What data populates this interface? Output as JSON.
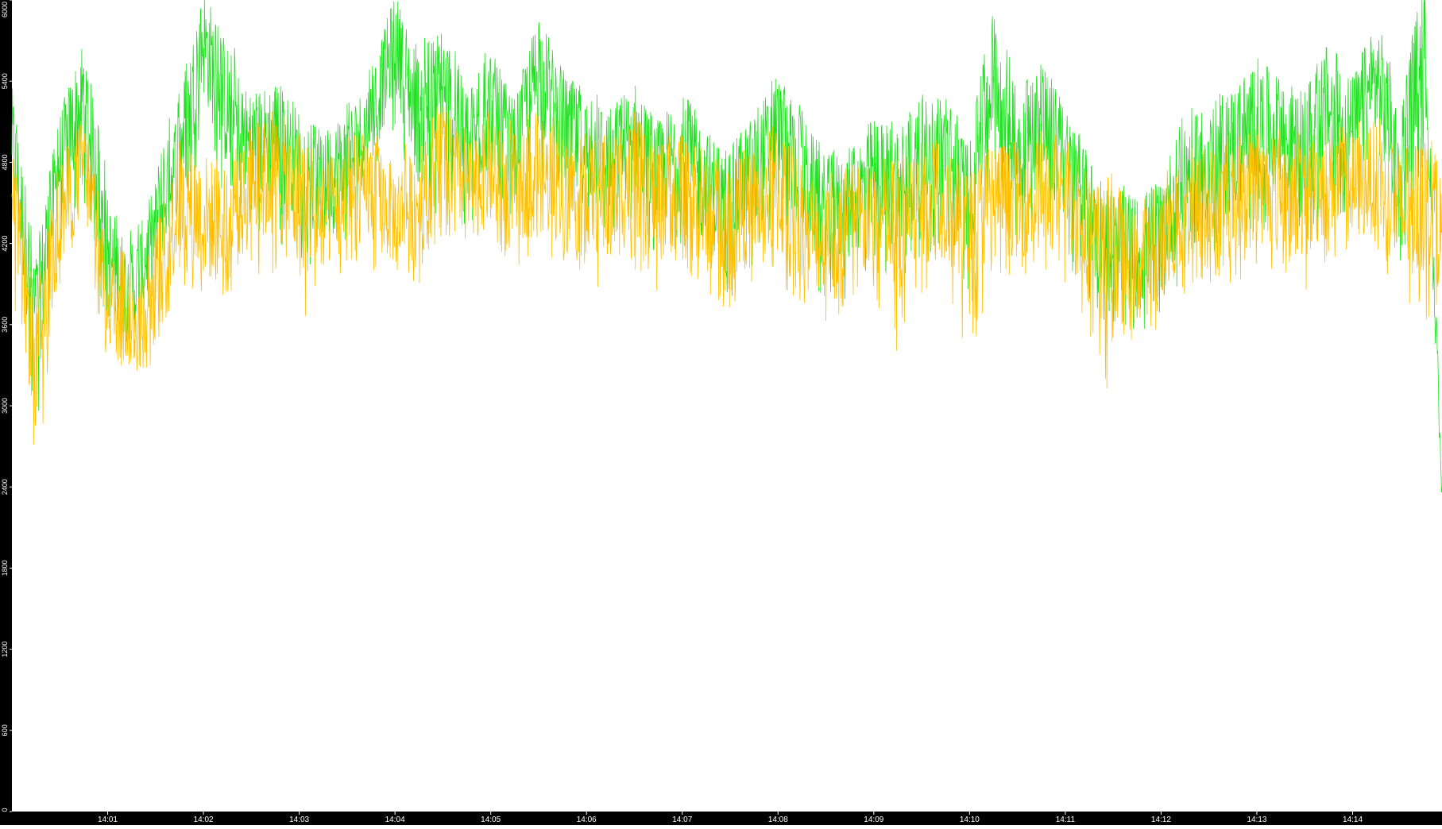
{
  "chart_data": {
    "type": "line",
    "title": "",
    "xlabel": "",
    "ylabel": "",
    "ylim": [
      0,
      6000
    ],
    "grid": false,
    "legend": "none",
    "yticks": [
      "0",
      "600",
      "1200",
      "1800",
      "2400",
      "3000",
      "3600",
      "4200",
      "4800",
      "5400",
      "6000"
    ],
    "xticks": [
      "14:01",
      "14:02",
      "14:03",
      "14:04",
      "14:05",
      "14:06",
      "14:07",
      "14:08",
      "14:09",
      "14:10",
      "14:11",
      "14:12",
      "14:13",
      "14:14"
    ],
    "x_range": [
      "14:00:00",
      "14:14:56"
    ],
    "colors": {
      "background": "#000000",
      "plot": "#ffffff",
      "green": "#22e022",
      "orange": "#ffc000"
    },
    "series": [
      {
        "color": "#22e022",
        "x": [
          "14:00:00",
          "14:00:15",
          "14:00:30",
          "14:00:45",
          "14:01:00",
          "14:01:15",
          "14:01:30",
          "14:01:45",
          "14:02:00",
          "14:02:15",
          "14:02:30",
          "14:02:45",
          "14:03:00",
          "14:03:15",
          "14:03:30",
          "14:03:45",
          "14:04:00",
          "14:04:15",
          "14:04:30",
          "14:04:45",
          "14:05:00",
          "14:05:15",
          "14:05:30",
          "14:05:45",
          "14:06:00",
          "14:06:15",
          "14:06:30",
          "14:06:45",
          "14:07:00",
          "14:07:15",
          "14:07:30",
          "14:07:45",
          "14:08:00",
          "14:08:15",
          "14:08:30",
          "14:08:45",
          "14:09:00",
          "14:09:15",
          "14:09:30",
          "14:09:45",
          "14:10:00",
          "14:10:15",
          "14:10:30",
          "14:10:45",
          "14:11:00",
          "14:11:15",
          "14:11:30",
          "14:11:45",
          "14:12:00",
          "14:12:15",
          "14:12:30",
          "14:12:45",
          "14:13:00",
          "14:13:15",
          "14:13:30",
          "14:13:45",
          "14:14:00",
          "14:14:15",
          "14:14:30",
          "14:14:45",
          "14:14:56"
        ],
        "values": [
          5000,
          3600,
          4800,
          5300,
          4100,
          3800,
          4300,
          4900,
          5700,
          5200,
          4900,
          5000,
          4800,
          4600,
          4800,
          5100,
          5700,
          5100,
          5300,
          4900,
          5200,
          4900,
          5500,
          5000,
          4900,
          4800,
          5000,
          4700,
          4900,
          4600,
          4500,
          4700,
          5000,
          4700,
          4400,
          4500,
          4700,
          4600,
          4800,
          4900,
          4500,
          5500,
          4900,
          5100,
          4800,
          4400,
          4200,
          4100,
          4300,
          4700,
          4800,
          4900,
          5100,
          5000,
          4900,
          5200,
          5000,
          5400,
          4800,
          5800,
          2400
        ],
        "min": [
          4400,
          2700,
          4200,
          4500,
          3500,
          3400,
          3800,
          4400,
          4900,
          4500,
          4300,
          4200,
          4100,
          3900,
          4200,
          4600,
          4900,
          4400,
          4400,
          4300,
          4500,
          4400,
          4700,
          4300,
          4300,
          4100,
          4300,
          4000,
          4200,
          3900,
          3800,
          3900,
          4300,
          4000,
          3700,
          3800,
          4000,
          3800,
          4100,
          4200,
          3800,
          4700,
          4100,
          4300,
          4100,
          3700,
          3600,
          3500,
          3700,
          3900,
          4100,
          4100,
          4300,
          4300,
          4200,
          4400,
          4300,
          4500,
          4000,
          4800,
          2300
        ],
        "max": [
          5400,
          4100,
          5200,
          5700,
          4700,
          4300,
          4800,
          5400,
          6000,
          5800,
          5300,
          5400,
          5200,
          5000,
          5300,
          5500,
          5900,
          5700,
          5900,
          5400,
          5700,
          5300,
          5900,
          5500,
          5400,
          5200,
          5400,
          5100,
          5400,
          5100,
          4900,
          5200,
          5500,
          5200,
          4900,
          4900,
          5200,
          5100,
          5300,
          5300,
          5000,
          6000,
          5400,
          5600,
          5200,
          4900,
          4700,
          4700,
          4800,
          5200,
          5300,
          5400,
          5600,
          5400,
          5400,
          5700,
          5500,
          5800,
          5300,
          6000,
          2600
        ]
      },
      {
        "color": "#ffc000",
        "x": [
          "14:00:00",
          "14:00:15",
          "14:00:30",
          "14:00:45",
          "14:01:00",
          "14:01:15",
          "14:01:30",
          "14:01:45",
          "14:02:00",
          "14:02:15",
          "14:02:30",
          "14:02:45",
          "14:03:00",
          "14:03:15",
          "14:03:30",
          "14:03:45",
          "14:04:00",
          "14:04:15",
          "14:04:30",
          "14:04:45",
          "14:05:00",
          "14:05:15",
          "14:05:30",
          "14:05:45",
          "14:06:00",
          "14:06:15",
          "14:06:30",
          "14:06:45",
          "14:07:00",
          "14:07:15",
          "14:07:30",
          "14:07:45",
          "14:08:00",
          "14:08:15",
          "14:08:30",
          "14:08:45",
          "14:09:00",
          "14:09:15",
          "14:09:30",
          "14:09:45",
          "14:10:00",
          "14:10:15",
          "14:10:30",
          "14:10:45",
          "14:11:00",
          "14:11:15",
          "14:11:30",
          "14:11:45",
          "14:12:00",
          "14:12:15",
          "14:12:30",
          "14:12:45",
          "14:13:00",
          "14:13:15",
          "14:13:30",
          "14:13:45",
          "14:14:00",
          "14:14:15",
          "14:14:30",
          "14:14:45",
          "14:14:56"
        ],
        "values": [
          4500,
          3300,
          4400,
          4800,
          3800,
          3600,
          3900,
          4500,
          4400,
          4300,
          4600,
          4700,
          4500,
          4400,
          4600,
          4600,
          4400,
          4500,
          4800,
          4600,
          4700,
          4600,
          4700,
          4600,
          4600,
          4500,
          4700,
          4500,
          4600,
          4400,
          4300,
          4500,
          4600,
          4400,
          4200,
          4300,
          4400,
          4300,
          4500,
          4500,
          4200,
          4600,
          4500,
          4600,
          4500,
          4200,
          4100,
          4000,
          4200,
          4400,
          4500,
          4500,
          4600,
          4600,
          4500,
          4700,
          4600,
          4700,
          4400,
          4500,
          4300
        ],
        "min": [
          3900,
          2300,
          3800,
          4200,
          3300,
          3200,
          3300,
          3900,
          3700,
          3700,
          4000,
          3900,
          3500,
          3900,
          4000,
          4000,
          3900,
          3900,
          4200,
          4100,
          4200,
          4000,
          4100,
          4000,
          4000,
          3700,
          4000,
          3800,
          4000,
          3800,
          3700,
          3900,
          3800,
          3700,
          3600,
          3700,
          3700,
          3300,
          3800,
          3900,
          3300,
          4000,
          3900,
          3900,
          3900,
          3500,
          2900,
          3400,
          3600,
          3800,
          3900,
          3900,
          4000,
          4000,
          3800,
          4100,
          4000,
          4100,
          3600,
          3600,
          3800
        ],
        "max": [
          5000,
          3700,
          4900,
          5200,
          4300,
          4100,
          4400,
          5000,
          5000,
          4800,
          5100,
          5200,
          5000,
          4900,
          5100,
          5100,
          4900,
          5000,
          5300,
          5100,
          5200,
          5100,
          5200,
          5100,
          5100,
          5000,
          5200,
          5000,
          5100,
          4900,
          4800,
          5000,
          5200,
          4900,
          4700,
          4800,
          4900,
          4800,
          5000,
          5000,
          4700,
          5100,
          5000,
          5100,
          5000,
          4700,
          4600,
          4500,
          4700,
          4900,
          5000,
          5000,
          5100,
          5100,
          5000,
          5200,
          5100,
          5200,
          4900,
          5000,
          4900
        ]
      }
    ]
  }
}
